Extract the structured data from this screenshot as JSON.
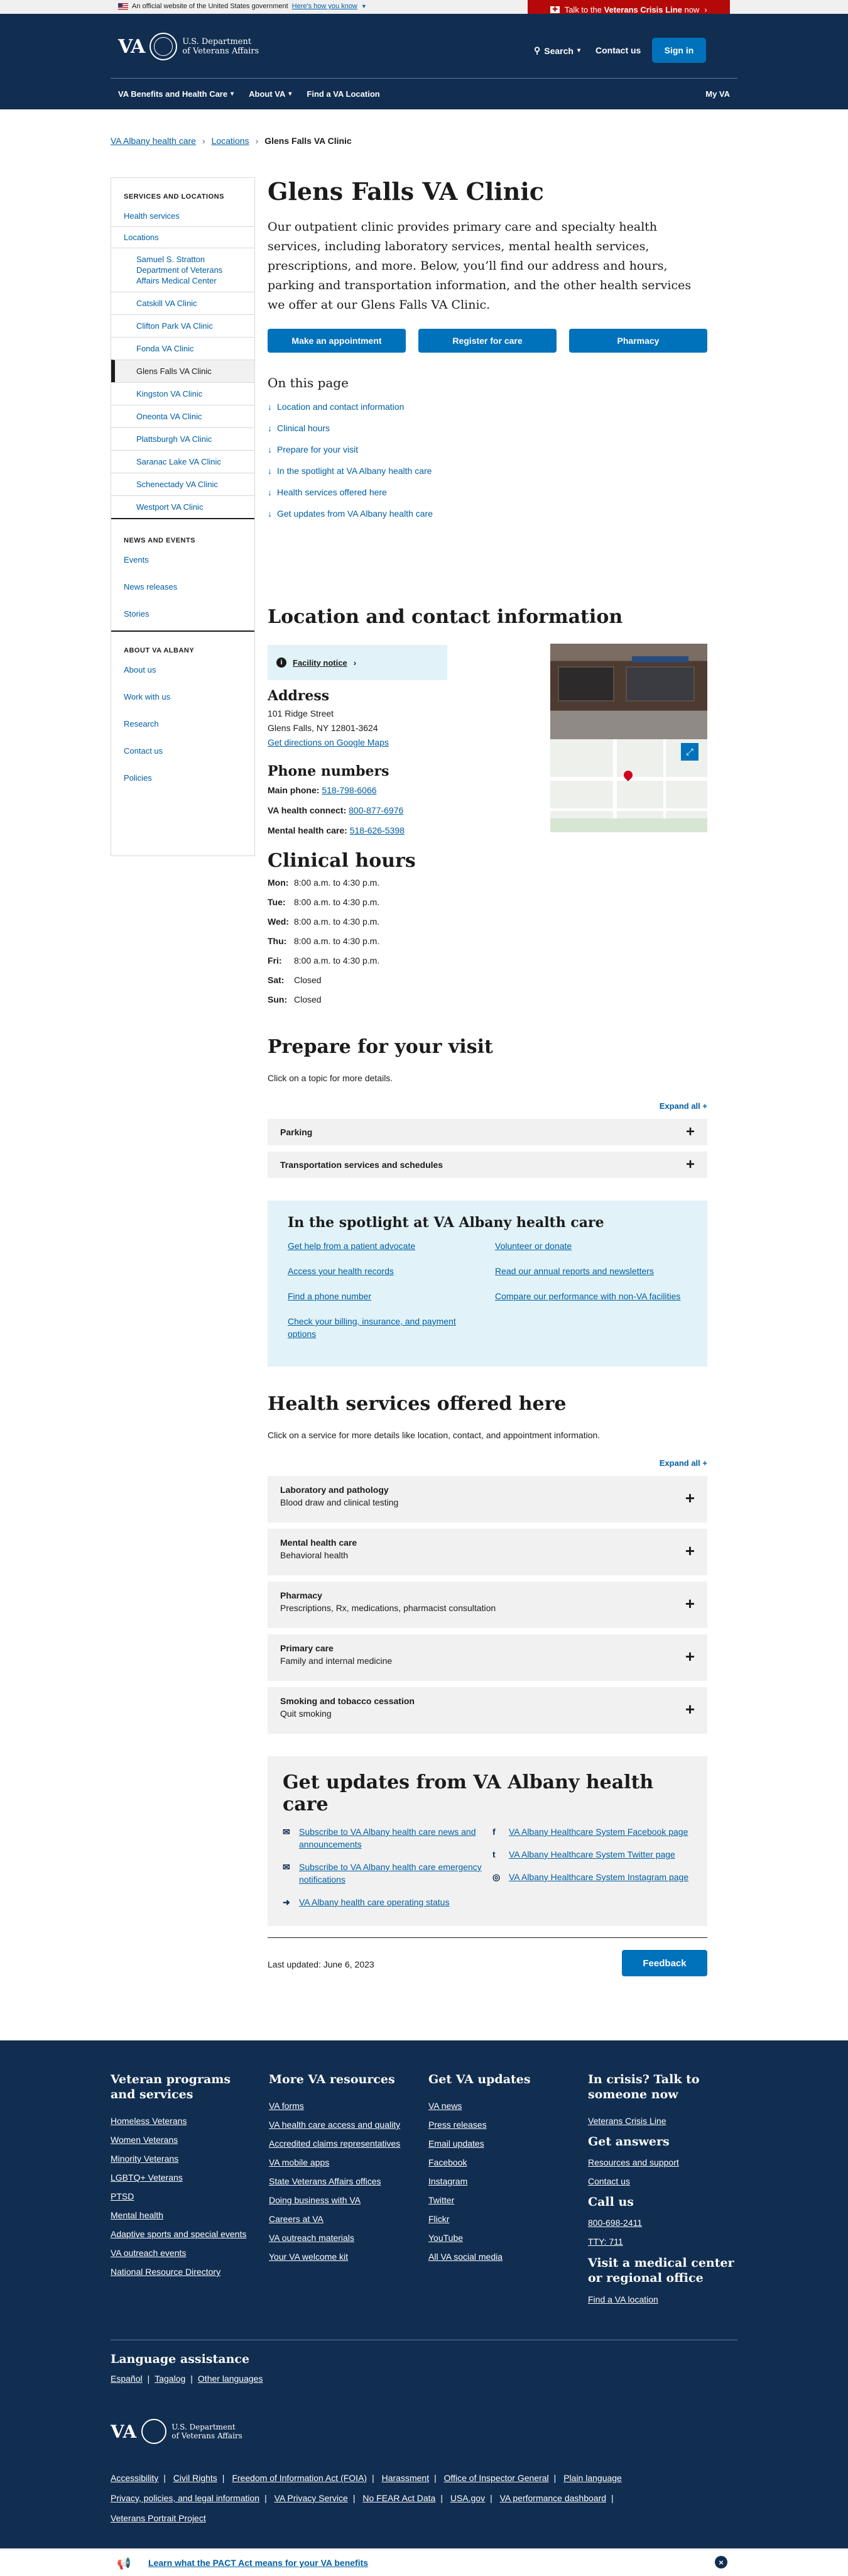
{
  "gov_banner": {
    "text": "An official website of the United States government",
    "link": "Here's how you know"
  },
  "crisis": {
    "prefix": "Talk to the ",
    "bold": "Veterans Crisis Line",
    "suffix": " now"
  },
  "header": {
    "logo_va": "VA",
    "logo_dept_1": "U.S. Department",
    "logo_dept_2": "of Veterans Affairs",
    "search": "Search",
    "contact": "Contact us",
    "signin": "Sign in",
    "nav": [
      "VA Benefits and Health Care",
      "About VA",
      "Find a VA Location"
    ],
    "nav_right": "My VA"
  },
  "breadcrumb": [
    "VA Albany health care",
    "Locations",
    "Glens Falls VA Clinic"
  ],
  "sidebar": {
    "heading1": "SERVICES AND LOCATIONS",
    "health_services": "Health services",
    "locations": "Locations",
    "sub": [
      "Samuel S. Stratton Department of Veterans Affairs Medical Center",
      "Catskill VA Clinic",
      "Clifton Park VA Clinic",
      "Fonda VA Clinic",
      "Glens Falls VA Clinic",
      "Kingston VA Clinic",
      "Oneonta VA Clinic",
      "Plattsburgh VA Clinic",
      "Saranac Lake VA Clinic",
      "Schenectady VA Clinic",
      "Westport VA Clinic"
    ],
    "heading2": "NEWS AND EVENTS",
    "news": [
      "Events",
      "News releases",
      "Stories"
    ],
    "heading3": "ABOUT VA ALBANY",
    "about": [
      "About us",
      "Work with us",
      "Research",
      "Contact us",
      "Policies"
    ]
  },
  "main": {
    "title": "Glens Falls VA Clinic",
    "intro": "Our outpatient clinic provides primary care and specialty health services, including laboratory services, mental health services, prescriptions, and more. Below, you’ll find our address and hours, parking and transportation information, and the other health services we offer at our Glens Falls VA Clinic.",
    "cta": [
      "Make an appointment",
      "Register for care",
      "Pharmacy"
    ],
    "on_this_page": "On this page",
    "otp": [
      "Location and contact information",
      "Clinical hours",
      "Prepare for your visit",
      "In the spotlight at VA Albany health care",
      "Health services offered here",
      "Get updates from VA Albany health care"
    ]
  },
  "location": {
    "title": "Location and contact information",
    "facility_notice": "Facility notice",
    "address_h": "Address",
    "address_1": "101 Ridge Street",
    "address_2": "Glens Falls, NY 12801-3624",
    "directions": "Get directions on Google Maps",
    "phones_h": "Phone numbers",
    "main_label": "Main phone:",
    "main_num": "518-798-6066",
    "connect_label": "VA health connect:",
    "connect_num": "800-877-6976",
    "mental_label": "Mental health care:",
    "mental_num": "518-626-5398"
  },
  "hours": {
    "title": "Clinical hours",
    "rows": [
      {
        "d": "Mon:",
        "h": "8:00 a.m. to 4:30 p.m."
      },
      {
        "d": "Tue:",
        "h": "8:00 a.m. to 4:30 p.m."
      },
      {
        "d": "Wed:",
        "h": "8:00 a.m. to 4:30 p.m."
      },
      {
        "d": "Thu:",
        "h": "8:00 a.m. to 4:30 p.m."
      },
      {
        "d": "Fri:",
        "h": "8:00 a.m. to 4:30 p.m."
      },
      {
        "d": "Sat:",
        "h": "Closed"
      },
      {
        "d": "Sun:",
        "h": "Closed"
      }
    ]
  },
  "prepare": {
    "title": "Prepare for your visit",
    "hint": "Click on a topic for more details.",
    "expand": "Expand all +",
    "items": [
      "Parking",
      "Transportation services and schedules"
    ]
  },
  "spotlight": {
    "title": "In the spotlight at VA Albany health care",
    "left": [
      "Get help from a patient advocate",
      "Access your health records",
      "Find a phone number",
      "Check your billing, insurance, and payment options"
    ],
    "right": [
      "Volunteer or donate",
      "Read our annual reports and newsletters",
      "Compare our performance with non-VA facilities"
    ]
  },
  "services": {
    "title": "Health services offered here",
    "hint": "Click on a service for more details like location, contact, and appointment information.",
    "expand": "Expand all +",
    "items": [
      {
        "t": "Laboratory and pathology",
        "s": "Blood draw and clinical testing"
      },
      {
        "t": "Mental health care",
        "s": "Behavioral health"
      },
      {
        "t": "Pharmacy",
        "s": "Prescriptions, Rx, medications, pharmacist consultation"
      },
      {
        "t": "Primary care",
        "s": "Family and internal medicine"
      },
      {
        "t": "Smoking and tobacco cessation",
        "s": "Quit smoking"
      }
    ]
  },
  "updates": {
    "title": "Get updates from VA Albany health care",
    "left": [
      "Subscribe to VA Albany health care news and announcements",
      "Subscribe to VA Albany health care emergency notifications",
      "VA Albany health care operating status"
    ],
    "right": [
      "VA Albany Healthcare System Facebook page",
      "VA Albany Healthcare System Twitter page",
      "VA Albany Healthcare System Instagram page"
    ]
  },
  "last_updated": "Last updated: June 6, 2023",
  "feedback": "Feedback",
  "footer": {
    "col1_h": "Veteran programs and services",
    "col1": [
      "Homeless Veterans",
      "Women Veterans",
      "Minority Veterans",
      "LGBTQ+ Veterans",
      "PTSD",
      "Mental health",
      "Adaptive sports and special events",
      "VA outreach events",
      "National Resource Directory"
    ],
    "col2_h": "More VA resources",
    "col2": [
      "VA forms",
      "VA health care access and quality",
      "Accredited claims representatives",
      "VA mobile apps",
      "State Veterans Affairs offices",
      "Doing business with VA",
      "Careers at VA",
      "VA outreach materials",
      "Your VA welcome kit"
    ],
    "col3_h": "Get VA updates",
    "col3": [
      "VA news",
      "Press releases",
      "Email updates",
      "Facebook",
      "Instagram",
      "Twitter",
      "Flickr",
      "YouTube",
      "All VA social media"
    ],
    "col4_h": "In crisis? Talk to someone now",
    "crisis_link": "Veterans Crisis Line",
    "answers_h": "Get answers",
    "answers": [
      "Resources and support",
      "Contact us"
    ],
    "call_h": "Call us",
    "call": [
      "800-698-2411",
      "TTY: 711"
    ],
    "visit_h": "Visit a medical center or regional office",
    "visit": "Find a VA location",
    "lang_h": "Language assistance",
    "lang": [
      "Español",
      "Tagalog",
      "Other languages"
    ],
    "legal": [
      "Accessibility",
      "Civil Rights",
      "Freedom of Information Act (FOIA)",
      "Harassment",
      "Office of Inspector General",
      "Plain language",
      "Privacy, policies, and legal information",
      "VA Privacy Service",
      "No FEAR Act Data",
      "USA.gov",
      "VA performance dashboard",
      "Veterans Portrait Project"
    ]
  },
  "pact": "Learn what the PACT Act means for your VA benefits"
}
